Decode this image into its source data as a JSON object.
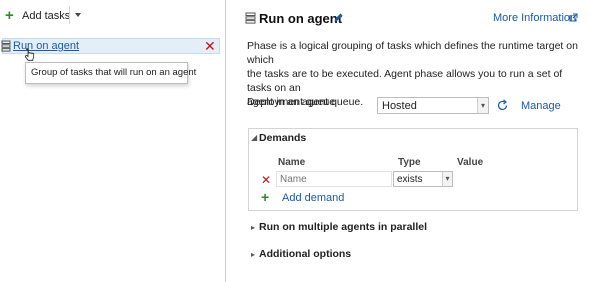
{
  "toolbar": {
    "add_tasks_label": "Add tasks",
    "add_icon": "plus-icon",
    "dropdown_icon": "caret-down-icon"
  },
  "left": {
    "phase_name": "Run on agent",
    "phase_icon": "server-icon",
    "remove_icon": "close-icon",
    "tooltip": "Group of tasks that will run on an agent"
  },
  "right": {
    "title": "Run on agent",
    "edit_icon": "pencil-icon",
    "more_info_label": "More Information",
    "description_lines": [
      "Phase is a logical grouping of tasks which defines the runtime target on which",
      "the tasks are to be executed. Agent phase allows you to run a set of tasks on an",
      "agent in an agent queue."
    ],
    "queue_label": "Deployment queue",
    "queue_value": "Hosted",
    "manage_label": "Manage",
    "demands": {
      "header": "Demands",
      "col_name": "Name",
      "col_type": "Type",
      "col_value": "Value",
      "name_placeholder": "Name",
      "type_value": "exists",
      "add_label": "Add demand"
    },
    "parallel_label": "Run on multiple agents in parallel",
    "additional_label": "Additional options"
  }
}
